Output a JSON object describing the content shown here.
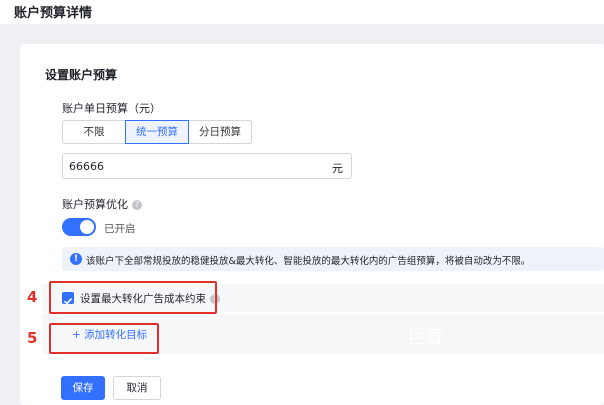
{
  "page": {
    "title": "账户预算详情"
  },
  "card": {
    "title": "设置账户预算",
    "daily_budget": {
      "label": "账户单日预算（元）",
      "options": [
        "不限",
        "统一预算",
        "分日预算"
      ],
      "selected": "统一预算",
      "value": "66666",
      "unit": "元"
    },
    "optimization": {
      "label": "账户预算优化",
      "help_icon": "question-circle-icon",
      "toggle_state": "on",
      "toggle_label": "已开启",
      "notice_icon": "info-circle-icon",
      "notice": "该账户下全部常规投放的稳健投放&最大转化、智能投放的最大转化内的广告组预算，将被自动改为不限。"
    },
    "constraint": {
      "checked": true,
      "label": "设置最大转化广告成本约束",
      "help_icon": "question-circle-icon"
    },
    "add_goal": {
      "icon": "plus-icon",
      "label": "+ 添加转化目标"
    },
    "watermark": "巨宣",
    "actions": {
      "save": "保存",
      "cancel": "取消"
    }
  },
  "annotations": {
    "step4": "4",
    "step5": "5"
  },
  "colors": {
    "accent": "#3370ff",
    "highlight": "#e0302a"
  }
}
